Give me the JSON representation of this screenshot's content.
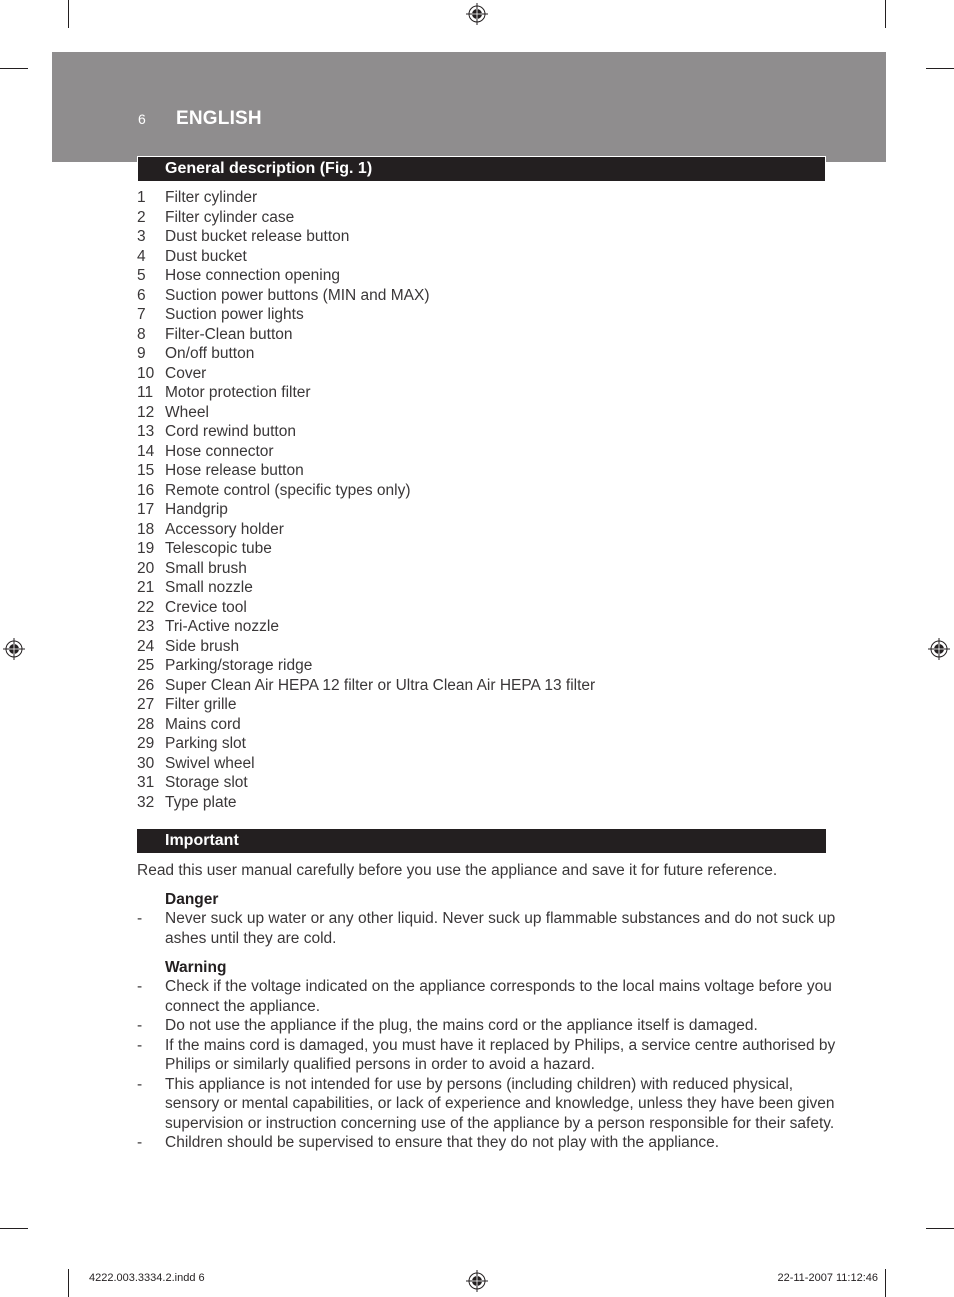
{
  "header": {
    "page_number": "6",
    "language": "ENGLISH",
    "band_color": "#8f8d8e",
    "bar_color": "#231f20"
  },
  "general_description": {
    "title": "General description (Fig. 1)",
    "items": [
      {
        "num": "1",
        "label": "Filter cylinder"
      },
      {
        "num": "2",
        "label": "Filter cylinder case"
      },
      {
        "num": "3",
        "label": "Dust bucket release button"
      },
      {
        "num": "4",
        "label": "Dust bucket"
      },
      {
        "num": "5",
        "label": "Hose connection opening"
      },
      {
        "num": "6",
        "label": "Suction power buttons (MIN and MAX)"
      },
      {
        "num": "7",
        "label": "Suction power lights"
      },
      {
        "num": "8",
        "label": "Filter-Clean button"
      },
      {
        "num": "9",
        "label": "On/off button"
      },
      {
        "num": "10",
        "label": "Cover"
      },
      {
        "num": "11",
        "label": "Motor protection filter"
      },
      {
        "num": "12",
        "label": "Wheel"
      },
      {
        "num": "13",
        "label": "Cord rewind button"
      },
      {
        "num": "14",
        "label": "Hose connector"
      },
      {
        "num": "15",
        "label": "Hose release button"
      },
      {
        "num": "16",
        "label": "Remote control (specific types only)"
      },
      {
        "num": "17",
        "label": "Handgrip"
      },
      {
        "num": "18",
        "label": "Accessory holder"
      },
      {
        "num": "19",
        "label": "Telescopic tube"
      },
      {
        "num": "20",
        "label": "Small brush"
      },
      {
        "num": "21",
        "label": "Small nozzle"
      },
      {
        "num": "22",
        "label": "Crevice tool"
      },
      {
        "num": "23",
        "label": "Tri-Active nozzle"
      },
      {
        "num": "24",
        "label": "Side brush"
      },
      {
        "num": "25",
        "label": "Parking/storage ridge"
      },
      {
        "num": "26",
        "label": "Super Clean Air HEPA 12 filter or Ultra Clean Air HEPA 13 filter"
      },
      {
        "num": "27",
        "label": "Filter grille"
      },
      {
        "num": "28",
        "label": "Mains cord"
      },
      {
        "num": "29",
        "label": "Parking slot"
      },
      {
        "num": "30",
        "label": "Swivel wheel"
      },
      {
        "num": "31",
        "label": "Storage slot"
      },
      {
        "num": "32",
        "label": "Type plate"
      }
    ]
  },
  "important": {
    "title": "Important",
    "intro": "Read this user manual carefully before you use the appliance and save it for future reference.",
    "danger": {
      "title": "Danger",
      "bullets": [
        {
          "dash": "-",
          "text": "Never suck up water or any other liquid. Never suck up flammable substances and do not suck up ashes until they are cold."
        }
      ]
    },
    "warning": {
      "title": "Warning",
      "bullets": [
        {
          "dash": "-",
          "text": "Check if the voltage indicated on the appliance corresponds to the local mains voltage before you connect the appliance."
        },
        {
          "dash": "-",
          "text": "Do not use the appliance if the plug, the mains cord or the appliance itself is damaged."
        },
        {
          "dash": "-",
          "text": "If the mains cord is damaged, you must have it replaced by Philips, a service centre authorised by Philips or similarly qualified persons in order to avoid a hazard."
        },
        {
          "dash": "-",
          "text": "This appliance is not intended for use by persons (including children) with reduced physical, sensory or mental capabilities, or lack of experience and knowledge, unless they have been given supervision or instruction concerning use of the appliance by a person responsible for their safety."
        },
        {
          "dash": "-",
          "text": "Children should be supervised to ensure that they do not play with the appliance."
        }
      ]
    }
  },
  "slug": {
    "file": "4222.003.3334.2.indd   6",
    "timestamp": "22-11-2007   11:12:46"
  },
  "icons": {
    "registration_mark": "registration-mark-icon"
  }
}
